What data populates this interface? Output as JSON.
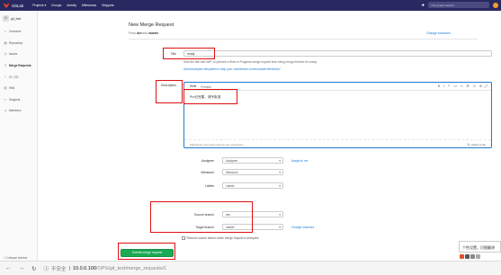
{
  "topbar": {
    "brand": "GitLab",
    "menu": [
      "Projects ▾",
      "Groups",
      "Activity",
      "Milestones",
      "Snippets"
    ],
    "search_placeholder": "This project  Search",
    "plus_icon": "plus-icon",
    "avatar_icon": "user-avatar"
  },
  "sidebar": {
    "project_initial": "G",
    "project_name": "git_test",
    "items": [
      {
        "label": "Overview",
        "icon": "home-icon"
      },
      {
        "label": "Repository",
        "icon": "book-icon"
      },
      {
        "label": "Issues",
        "icon": "issues-icon"
      },
      {
        "label": "Merge Requests",
        "icon": "merge-icon"
      },
      {
        "label": "CI / CD",
        "icon": "rocket-icon"
      },
      {
        "label": "Wiki",
        "icon": "book-open-icon"
      },
      {
        "label": "Snippets",
        "icon": "scissors-icon"
      },
      {
        "label": "Members",
        "icon": "users-icon"
      }
    ],
    "active_index": 3,
    "collapse_label": "« Collapse sidebar"
  },
  "form": {
    "title": "New Merge Request",
    "from_prefix": "From",
    "from_source": "dev",
    "from_middle": "into",
    "from_target": "master",
    "change_branches": "Change branches",
    "title_label": "Title",
    "title_value": "ready",
    "title_hint": "Start the title with WIP: to prevent a Work In Progress merge request from being merged before it's ready.",
    "template_hint": "Add description templates to help your contributors communicate effectively!",
    "description_label": "Description",
    "tab_write": "Write",
    "tab_preview": "Preview",
    "description_text": "Pro已完善，请予批准",
    "markdown_hint": "Markdown and quick actions are supported",
    "attach_file": "Attach a file",
    "assignee_label": "Assignee",
    "assignee_value": "Assignee",
    "assign_to_me": "Assign to me",
    "milestone_label": "Milestone",
    "milestone_value": "Milestone",
    "labels_label": "Labels",
    "labels_value": "Labels",
    "source_label": "Source branch",
    "source_value": "dev",
    "target_label": "Target branch",
    "target_value": "master",
    "change_branches_2": "Change branches",
    "remove_source": "Remove source branch when merge request is accepted.",
    "submit": "Submit merge request"
  },
  "toolbar_icons": [
    "B",
    "I",
    "❝",
    "<>",
    "≡",
    "☰",
    "☑",
    "⊞"
  ],
  "browser": {
    "insecure": "不安全",
    "host": "10.0.0.100",
    "path": "/OPS/git_test/merge_requests/1"
  },
  "ime": {
    "text": "个性设置，识图翻译"
  },
  "colors": {
    "topbar": "#292961",
    "link": "#1f78d1",
    "submit": "#1aaa55",
    "annotation": "#e01010"
  }
}
